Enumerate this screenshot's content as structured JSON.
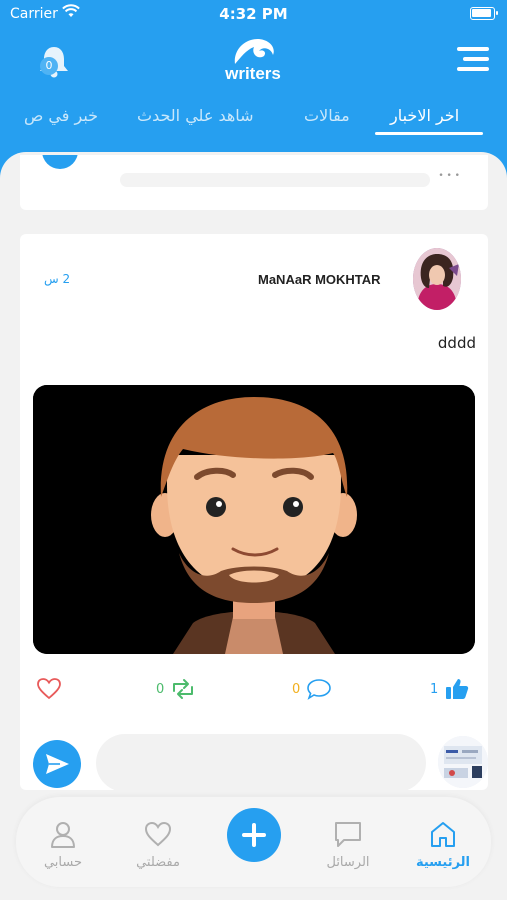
{
  "status_bar": {
    "carrier": "Carrier",
    "time": "4:32 PM"
  },
  "header": {
    "notification_count": "0",
    "logo_text": "writers"
  },
  "tabs": [
    {
      "label": "اخر الاخبار",
      "active": true
    },
    {
      "label": "مقالات",
      "active": false
    },
    {
      "label": "شاهد علي الحدث",
      "active": false
    },
    {
      "label": "خبر في ص",
      "active": false
    }
  ],
  "post": {
    "author": "MaNAaR MOKHTAR",
    "time": "2 س",
    "text": "dddd",
    "likes": "1",
    "comments": "0",
    "reposts": "0"
  },
  "comment": {
    "placeholder": ""
  },
  "bottom_nav": {
    "home": "الرئيسية",
    "messages": "الرسائل",
    "favorites": "مفضلتي",
    "account": "حسابي"
  },
  "colors": {
    "primary": "#269ff0",
    "heart": "#e85a5a",
    "repost": "#4cbb6c",
    "comment": "#f2b01e"
  }
}
